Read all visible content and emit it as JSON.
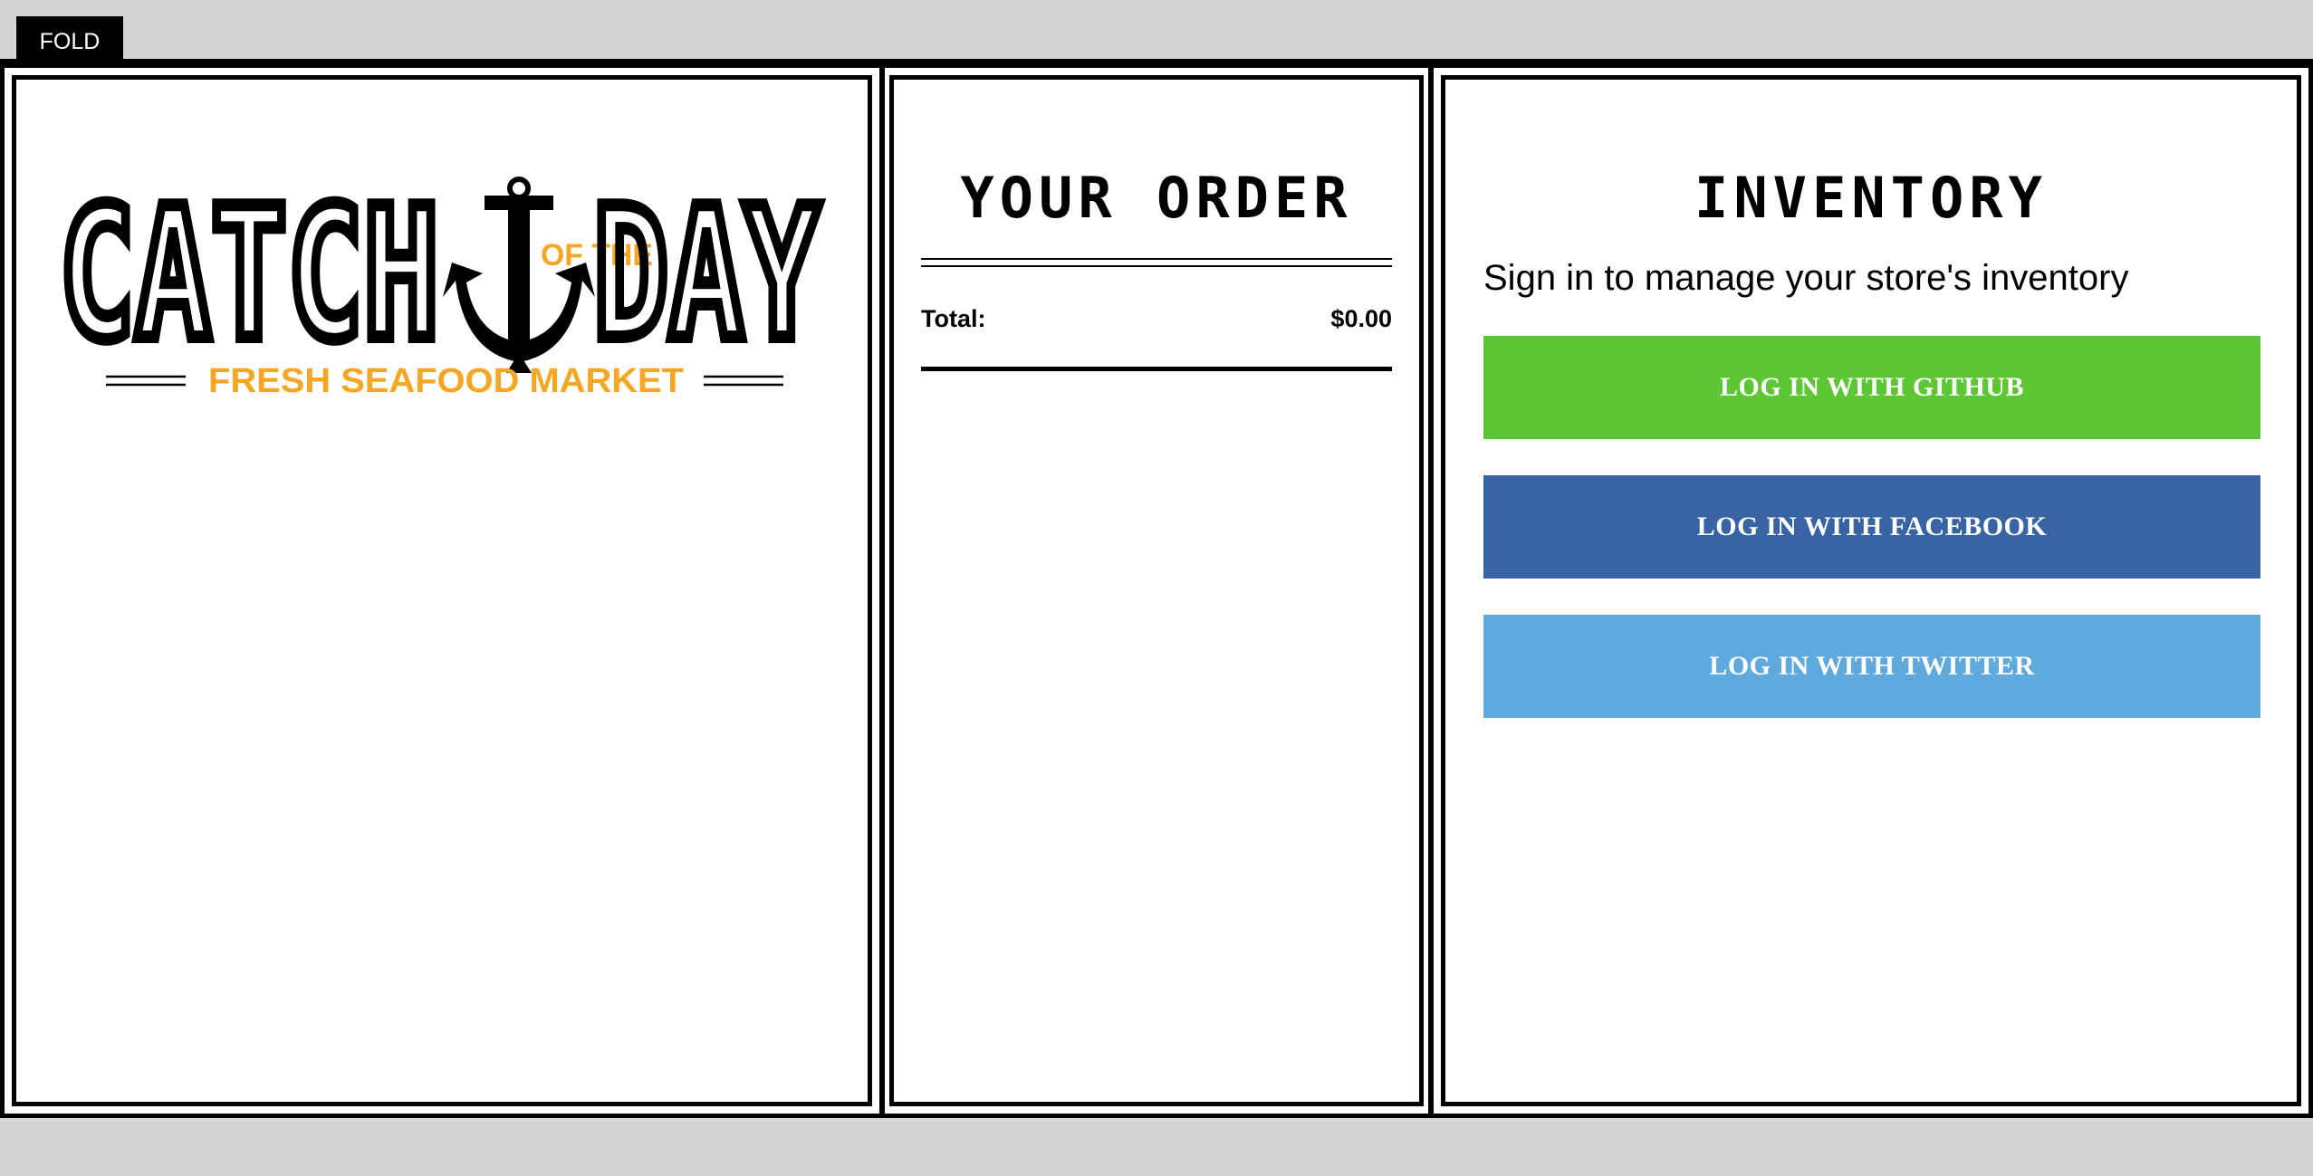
{
  "fold_button": {
    "label": "FOLD"
  },
  "logo": {
    "word_left": "CATCH",
    "word_mid": "OF THE",
    "word_right": "DAY",
    "tagline": "FRESH SEAFOOD MARKET",
    "colors": {
      "main": "#000000",
      "accent": "#f5a623"
    },
    "icon": "anchor-icon"
  },
  "order": {
    "title": "YOUR ORDER",
    "total_label": "Total:",
    "total_value": "$0.00"
  },
  "inventory": {
    "title": "INVENTORY",
    "prompt": "Sign in to manage your store's inventory",
    "buttons": [
      {
        "label": "LOG IN WITH GITHUB",
        "color": "#5dc635"
      },
      {
        "label": "LOG IN WITH FACEBOOK",
        "color": "#3864a3"
      },
      {
        "label": "LOG IN WITH TWITTER",
        "color": "#5ea9dd"
      }
    ]
  }
}
